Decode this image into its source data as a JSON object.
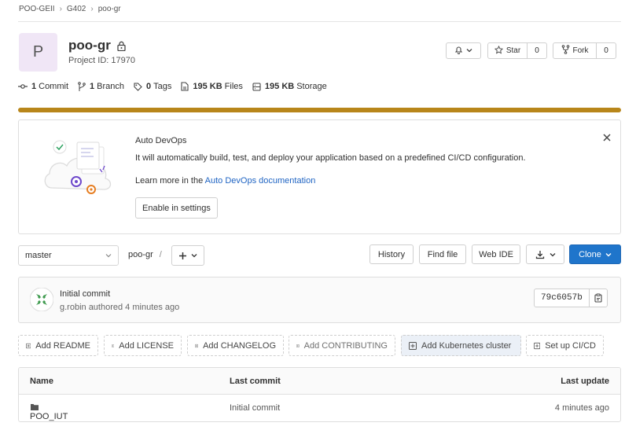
{
  "breadcrumb": [
    "POO-GEII",
    "G402",
    "poo-gr"
  ],
  "project": {
    "avatar_letter": "P",
    "name": "poo-gr",
    "id_text": "Project ID: 17970"
  },
  "actions": {
    "star_label": "Star",
    "star_count": "0",
    "fork_label": "Fork",
    "fork_count": "0"
  },
  "stats": [
    {
      "icon": "commit-icon",
      "bold": "1",
      "label": "Commit"
    },
    {
      "icon": "branch-icon",
      "bold": "1",
      "label": "Branch"
    },
    {
      "icon": "tag-icon",
      "bold": "0",
      "label": "Tags"
    },
    {
      "icon": "file-icon",
      "bold": "195 KB",
      "label": "Files"
    },
    {
      "icon": "storage-icon",
      "bold": "195 KB",
      "label": "Storage"
    }
  ],
  "storage_progress": 1.0,
  "colors": {
    "accent": "#1f75cb",
    "progress": "#b8861a",
    "link": "#1f64c3"
  },
  "devops": {
    "title": "Auto DevOps",
    "description": "It will automatically build, test, and deploy your application based on a predefined CI/CD configuration.",
    "learn_prefix": "Learn more in the ",
    "learn_link": "Auto DevOps documentation",
    "button": "Enable in settings"
  },
  "toolbar": {
    "branch": "master",
    "path": "poo-gr",
    "path_sep": "/",
    "history": "History",
    "find_file": "Find file",
    "web_ide": "Web IDE",
    "clone": "Clone"
  },
  "last_commit": {
    "title": "Initial commit",
    "meta": "g.robin authored 4 minutes ago",
    "sha": "79c6057b"
  },
  "quick_add": [
    "Add README",
    "Add LICENSE",
    "Add CHANGELOG",
    "Add CONTRIBUTING",
    "Add Kubernetes cluster",
    "Set up CI/CD"
  ],
  "table": {
    "headers": [
      "Name",
      "Last commit",
      "Last update"
    ],
    "rows": [
      {
        "name": "POO_IUT",
        "commit": "Initial commit",
        "updated": "4 minutes ago"
      }
    ]
  }
}
